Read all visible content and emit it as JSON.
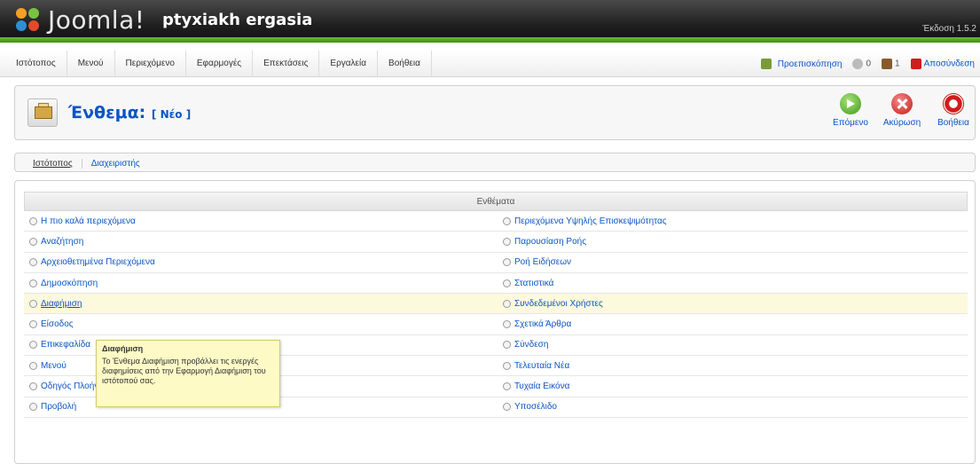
{
  "header": {
    "logo_text": "Joomla!",
    "logo_mark": "joomla-logo-icon",
    "site_name": "ptyxiakh ergasia",
    "version": "Έκδοση 1.5.2"
  },
  "menu": {
    "items": [
      {
        "label": "Ιστότοπος"
      },
      {
        "label": "Μενού"
      },
      {
        "label": "Περιεχόμενο"
      },
      {
        "label": "Εφαρμογές"
      },
      {
        "label": "Επεκτάσεις"
      },
      {
        "label": "Εργαλεία"
      },
      {
        "label": "Βοήθεια"
      }
    ]
  },
  "status": {
    "preview_label": "Προεπισκόπηση",
    "preview_icon": "preview-icon",
    "messages_count": "0",
    "messages_icon": "messages-icon",
    "users_count": "1",
    "users_icon": "users-icon",
    "logout_label": "Αποσύνδεση",
    "logout_icon": "logout-icon"
  },
  "toolbar": {
    "title": "Ένθεμα:",
    "subtitle": "[ Νέο ]",
    "icon": "module-icon",
    "next_label": "Επόμενο",
    "cancel_label": "Ακύρωση",
    "help_label": "Βοήθεια"
  },
  "tabs": [
    {
      "label": "Ιστότοπος",
      "active": true
    },
    {
      "label": "Διαχειριστής",
      "active": false
    }
  ],
  "modules": {
    "header": "Ενθέματα",
    "left": [
      "Η πιο καλά περιεχόμενα",
      "Αναζήτηση",
      "Αρχειοθετημένα Περιεχόμενα",
      "Δημοσκόπηση",
      "Διαφήμιση",
      "Είσοδος",
      "Επικεφαλίδα",
      "Μενού",
      "Οδηγός Πλοήγησης",
      "Προβολή"
    ],
    "right": [
      "Περιεχόμενα Υψηλής Επισκεψιμότητας",
      "Παρουσίαση Ροής",
      "Ροή Ειδήσεων",
      "Στατιστικά",
      "Συνδεδεμένοι Χρήστες",
      "Σχετικά Άρθρα",
      "Σύνδεση",
      "Τελευταία Νέα",
      "Τυχαία Εικόνα",
      "Υποσέλιδο"
    ],
    "highlighted_row": 4
  },
  "tooltip": {
    "title": "Διαφήμιση",
    "text": "Το Ένθεμα Διαφήμιση προβάλλει τις ενεργές διαφημίσεις από την Εφαρμογή Διαφήμιση του ιστότοπού σας."
  }
}
